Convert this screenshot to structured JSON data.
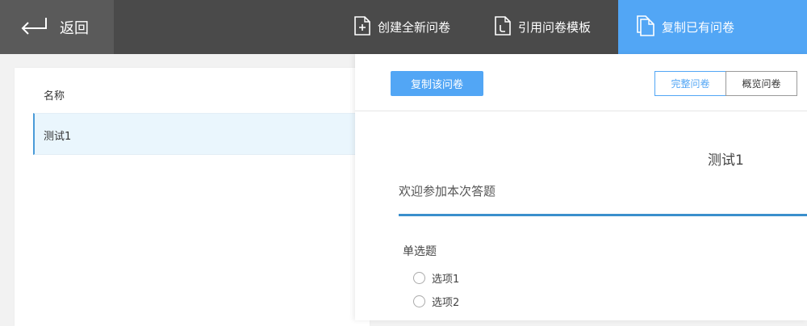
{
  "topbar": {
    "back_label": "返回",
    "tabs": [
      {
        "label": "创建全新问卷",
        "icon": "new-document-icon"
      },
      {
        "label": "引用问卷模板",
        "icon": "template-document-icon"
      },
      {
        "label": "复制已有问卷",
        "icon": "copy-document-icon",
        "active": true
      }
    ],
    "colors": {
      "bar": "#4a4a4a",
      "back_bg": "#5a5a5a",
      "active_tab": "#52a6f5"
    }
  },
  "left_panel": {
    "column_header": "名称",
    "rows": [
      {
        "label": "测试1",
        "selected": true
      }
    ]
  },
  "right_panel": {
    "copy_button_label": "复制该问卷",
    "view_toggle": [
      {
        "label": "完整问卷",
        "active": true
      },
      {
        "label": "概览问卷",
        "active": false
      }
    ],
    "survey": {
      "title": "测试1",
      "welcome": "欢迎参加本次答题",
      "questions": [
        {
          "title": "单选题",
          "type": "single-choice",
          "options": [
            "选项1",
            "选项2"
          ]
        }
      ]
    }
  }
}
